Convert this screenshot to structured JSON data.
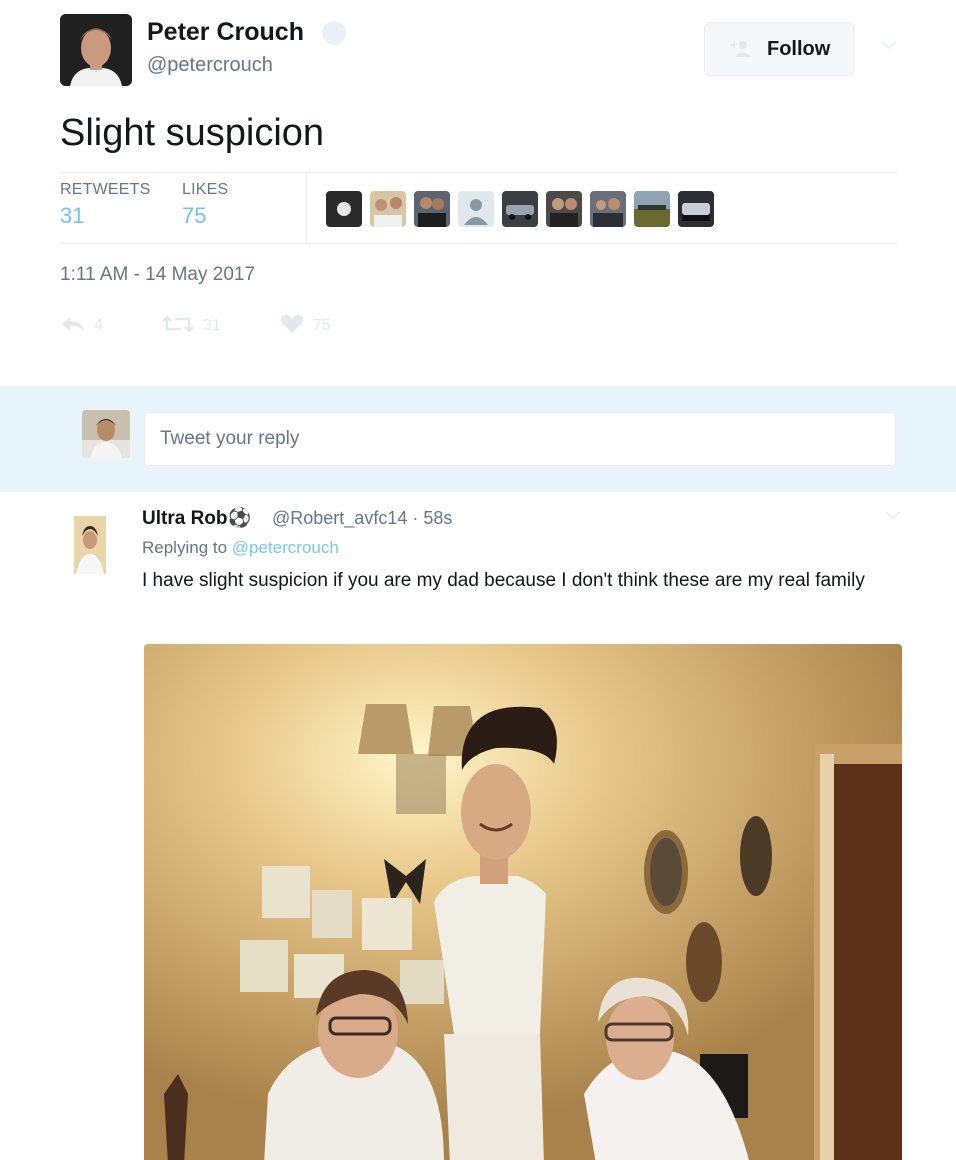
{
  "tweet": {
    "author_name": "Peter Crouch",
    "author_handle": "@petercrouch",
    "follow_label": "Follow",
    "text": "Slight suspicion",
    "stats": {
      "retweets_label": "RETWEETS",
      "retweets_value": "31",
      "likes_label": "LIKES",
      "likes_value": "75"
    },
    "timestamp": "1:11 AM - 14 May 2017",
    "actions": {
      "reply_count": "4",
      "retweet_count": "31",
      "like_count": "75"
    }
  },
  "reply_box": {
    "placeholder": "Tweet your reply"
  },
  "reply": {
    "author_name": "Ultra Rob⚽",
    "meta": "@Robert_avfc14 · 58s",
    "replying_prefix": "Replying to",
    "replying_to": "@petercrouch",
    "text": "I have slight suspicion if you are my dad because I don't think these are my real family"
  },
  "colors": {
    "link": "#6ec7e5",
    "muted": "#657786",
    "reply_bg": "#e8f4fb",
    "border": "#e6ecf0"
  },
  "icons": [
    "verified-icon",
    "follow-user-icon",
    "caret-down-icon",
    "reply-icon",
    "retweet-icon",
    "like-icon"
  ]
}
